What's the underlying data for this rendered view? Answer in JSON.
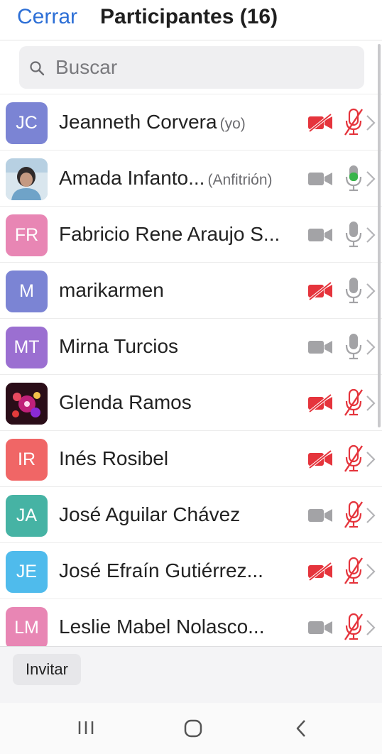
{
  "header": {
    "close_label": "Cerrar",
    "title": "Participantes (16)"
  },
  "search": {
    "placeholder": "Buscar"
  },
  "participants": [
    {
      "initials": "JC",
      "name": "Jeanneth Corvera",
      "role": "(yo)",
      "avatar_color": "#7b84d4",
      "avatar_type": "initials",
      "camera_on": false,
      "mic_state": "muted"
    },
    {
      "initials": "",
      "name": "Amada Infanto...",
      "role": "(Anfitrión)",
      "avatar_color": "#9ec2d8",
      "avatar_type": "photo",
      "camera_on": true,
      "mic_state": "active"
    },
    {
      "initials": "FR",
      "name": "Fabricio Rene Araujo S...",
      "role": "",
      "avatar_color": "#e886b4",
      "avatar_type": "initials",
      "camera_on": true,
      "mic_state": "on"
    },
    {
      "initials": "M",
      "name": "marikarmen",
      "role": "",
      "avatar_color": "#7b84d4",
      "avatar_type": "initials",
      "camera_on": false,
      "mic_state": "on"
    },
    {
      "initials": "MT",
      "name": "Mirna Turcios",
      "role": "",
      "avatar_color": "#9b6fd1",
      "avatar_type": "initials",
      "camera_on": true,
      "mic_state": "on"
    },
    {
      "initials": "",
      "name": "Glenda Ramos",
      "role": "",
      "avatar_color": "#3a1222",
      "avatar_type": "photo-flowers",
      "camera_on": false,
      "mic_state": "muted"
    },
    {
      "initials": "IR",
      "name": "Inés Rosibel",
      "role": "",
      "avatar_color": "#f06666",
      "avatar_type": "initials",
      "camera_on": false,
      "mic_state": "muted"
    },
    {
      "initials": "JA",
      "name": "José Aguilar Chávez",
      "role": "",
      "avatar_color": "#46b3a4",
      "avatar_type": "initials",
      "camera_on": true,
      "mic_state": "muted"
    },
    {
      "initials": "JE",
      "name": "José Efraín Gutiérrez...",
      "role": "",
      "avatar_color": "#4fbbec",
      "avatar_type": "initials",
      "camera_on": false,
      "mic_state": "muted"
    },
    {
      "initials": "LM",
      "name": "Leslie Mabel Nolasco...",
      "role": "",
      "avatar_color": "#e886b4",
      "avatar_type": "initials",
      "camera_on": true,
      "mic_state": "muted"
    }
  ],
  "footer": {
    "invite_label": "Invitar"
  },
  "colors": {
    "accent": "#2d6fd6",
    "muted_red": "#e5343c",
    "icon_gray": "#a3a3a6",
    "mic_active_green": "#38b44a"
  },
  "navbar": {
    "icons": [
      "recent-apps-icon",
      "home-icon",
      "back-icon"
    ]
  }
}
